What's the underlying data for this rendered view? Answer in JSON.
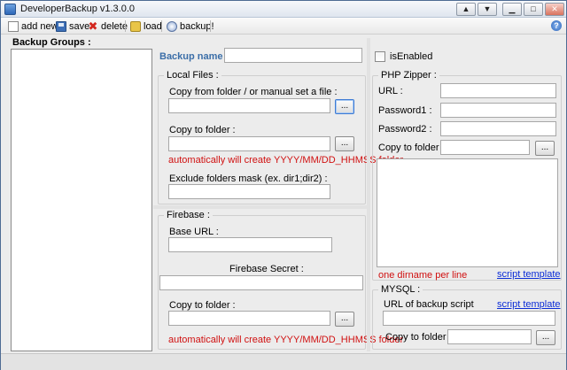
{
  "window": {
    "title": "DeveloperBackup v1.3.0.0",
    "controls": [
      "▲",
      "▼",
      "🗗",
      "✕"
    ]
  },
  "toolbar": {
    "add_new": "add new",
    "save": "save",
    "delete": "delete",
    "load": "load",
    "backup": "backup!",
    "help_glyph": "?"
  },
  "left": {
    "backup_groups_label": "Backup Groups :"
  },
  "header": {
    "backup_name_label": "Backup name :",
    "backup_name_value": "",
    "is_enabled_label": "isEnabled",
    "is_enabled_checked": false
  },
  "local_files": {
    "title": "Local Files :",
    "copy_from_label": "Copy from folder / or manual set a file :",
    "copy_from_value": "",
    "browse_label": "...",
    "copy_to_label": "Copy to folder :",
    "copy_to_value": "",
    "copy_to_browse": "...",
    "auto_note": "automatically will create YYYY/MM/DD_HHMSS folder",
    "exclude_label": "Exclude folders mask (ex. dir1;dir2) :",
    "exclude_value": ""
  },
  "firebase": {
    "title": "Firebase :",
    "base_url_label": "Base URL :",
    "base_url_value": "",
    "secret_label": "Firebase Secret :",
    "secret_value": "",
    "copy_to_label": "Copy to folder :",
    "copy_to_value": "",
    "browse_label": "...",
    "auto_note": "automatically will create YYYY/MM/DD_HHMSS folder"
  },
  "php_zipper": {
    "title": "PHP Zipper :",
    "url_label": "URL :",
    "password1_label": "Password1 :",
    "password2_label": "Password2 :",
    "copy_to_label": "Copy to folder :",
    "browse_label": "...",
    "dirname_note": "one dirname per line",
    "script_template_link": "script template"
  },
  "mysql": {
    "title": "MYSQL :",
    "url_label": "URL of backup script",
    "script_template_link": "script template",
    "copy_to_label": "Copy to folder :",
    "browse_label": "..."
  }
}
